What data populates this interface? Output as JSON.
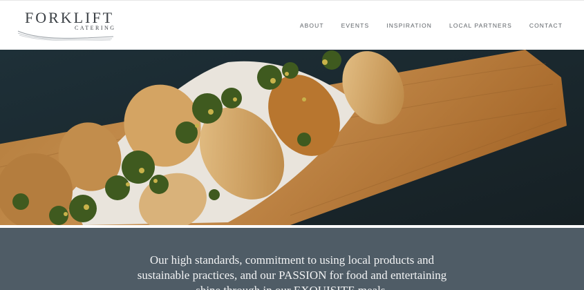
{
  "brand": {
    "title": "FORKLIFT",
    "subtitle": "CATERING"
  },
  "nav": {
    "items": [
      "ABOUT",
      "EVENTS",
      "INSPIRATION",
      "LOCAL PARTNERS",
      "CONTACT"
    ]
  },
  "hero": {
    "image_icon": "grilled-mushrooms-photo-icon"
  },
  "intro": {
    "line1": "Our high standards, commitment to using local products and",
    "line2": "sustainable practices, and our PASSION for food and entertaining",
    "line3": "shine through in our EXQUISITE meals."
  },
  "colors": {
    "band": "#4f5c66",
    "text_dark": "#3a3f44",
    "nav_text": "#5c6166"
  }
}
